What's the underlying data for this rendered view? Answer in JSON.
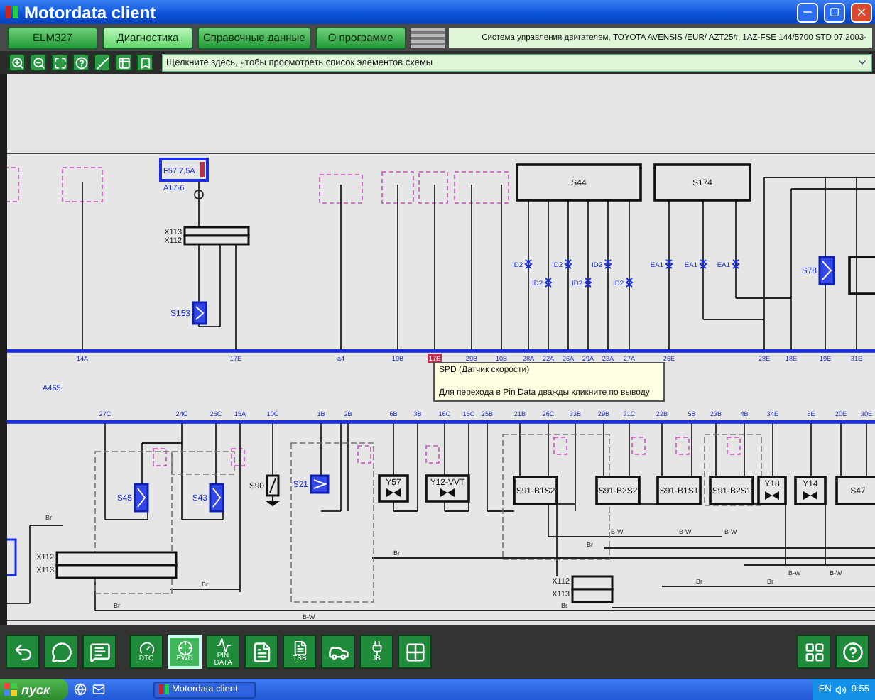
{
  "window": {
    "title": "Motordata client"
  },
  "tabs": [
    {
      "label": "ELM327",
      "selected": false
    },
    {
      "label": "Диагностика",
      "selected": true
    },
    {
      "label": "Справочные данные",
      "selected": false
    },
    {
      "label": "О программе",
      "selected": false
    }
  ],
  "vehicle_info": "Система управления двигателем, TOYOTA AVENSIS /EUR/ AZT25#,  1AZ-FSE 144/5700 STD 07.2003-",
  "element_list": {
    "value": "Щелкните здесь, чтобы просмотреть список элементов схемы"
  },
  "diagram": {
    "components": [
      {
        "label": "F57 7,5A",
        "kind": "fuse"
      },
      {
        "label": "S153",
        "kind": "sensor"
      },
      {
        "label": "S44",
        "kind": "unit"
      },
      {
        "label": "S174",
        "kind": "unit"
      },
      {
        "label": "S78",
        "kind": "sensor"
      },
      {
        "label": "S45",
        "kind": "sensor"
      },
      {
        "label": "S43",
        "kind": "sensor"
      },
      {
        "label": "S90",
        "kind": "switch"
      },
      {
        "label": "S21",
        "kind": "sensor"
      },
      {
        "label": "Y57",
        "kind": "valve"
      },
      {
        "label": "Y12-VVT",
        "kind": "valve"
      },
      {
        "label": "S91-B1S2",
        "kind": "unit"
      },
      {
        "label": "S91-B2S2",
        "kind": "unit"
      },
      {
        "label": "S91-B1S1",
        "kind": "unit"
      },
      {
        "label": "S91-B2S1",
        "kind": "unit"
      },
      {
        "label": "Y18",
        "kind": "valve"
      },
      {
        "label": "Y14",
        "kind": "valve"
      },
      {
        "label": "S47",
        "kind": "unit"
      }
    ],
    "connectors": [
      {
        "labels": [
          "X113",
          "X112"
        ]
      },
      {
        "labels": [
          "X112",
          "X113"
        ]
      },
      {
        "labels": [
          "X112",
          "X113"
        ]
      }
    ],
    "labels": [
      "A17-6",
      "A465"
    ],
    "upper_pins": [
      {
        "label": "14A",
        "highlighted": false
      },
      {
        "label": "17E",
        "highlighted": false
      },
      {
        "label": "a4",
        "highlighted": false
      },
      {
        "label": "19B",
        "highlighted": false
      },
      {
        "label": "17E",
        "highlighted": true
      },
      {
        "label": "29B",
        "highlighted": false
      },
      {
        "label": "10B",
        "highlighted": false
      },
      {
        "label": "28A",
        "highlighted": false
      },
      {
        "label": "22A",
        "highlighted": false
      },
      {
        "label": "26A",
        "highlighted": false
      },
      {
        "label": "29A",
        "highlighted": false
      },
      {
        "label": "23A",
        "highlighted": false
      },
      {
        "label": "27A",
        "highlighted": false
      },
      {
        "label": "26E",
        "highlighted": false
      },
      {
        "label": "28E",
        "highlighted": false
      },
      {
        "label": "18E",
        "highlighted": false
      },
      {
        "label": "19E",
        "highlighted": false
      },
      {
        "label": "31E",
        "highlighted": false
      }
    ],
    "lower_pins": [
      "27C",
      "24C",
      "25C",
      "15A",
      "10C",
      "1B",
      "2B",
      "6B",
      "3B",
      "16C",
      "15C",
      "25B",
      "21B",
      "26C",
      "33B",
      "29B",
      "31C",
      "22B",
      "5B",
      "23B",
      "4B",
      "34E",
      "5E",
      "20E",
      "30E"
    ],
    "splices": [
      "ID2",
      "ID2",
      "ID2",
      "ID2",
      "ID2",
      "ID2",
      "EA1",
      "EA1",
      "EA1"
    ],
    "wire_codes": [
      "Br",
      "Br",
      "Br",
      "Br",
      "B-W",
      "B-W",
      "B-W",
      "B-W",
      "B-W",
      "B-W",
      "Br",
      "Br",
      "Br",
      "Br"
    ]
  },
  "tooltip": {
    "title": "SPD (Датчик скорости)",
    "hint": "Для перехода в Pin Data дважды кликните по выводу"
  },
  "bottom_toolbar": [
    {
      "kind": "back",
      "selected": false
    },
    {
      "kind": "speech",
      "selected": false
    },
    {
      "kind": "notes",
      "selected": false
    },
    {
      "kind": "dtc",
      "label": "DTC",
      "selected": false
    },
    {
      "kind": "ewd",
      "label": "EWD",
      "selected": true
    },
    {
      "kind": "pin",
      "label": "PIN DATA",
      "selected": false
    },
    {
      "kind": "pad",
      "selected": false
    },
    {
      "kind": "tsb",
      "label": "TSB",
      "selected": false
    },
    {
      "kind": "car",
      "selected": false
    },
    {
      "kind": "jb",
      "label": "JB",
      "selected": false
    },
    {
      "kind": "grid",
      "selected": false
    },
    {
      "kind": "layout",
      "selected": false
    },
    {
      "kind": "help",
      "selected": false
    }
  ],
  "taskbar": {
    "start": "пуск",
    "task": "Motordata client",
    "language": "EN",
    "clock": "9:55"
  }
}
